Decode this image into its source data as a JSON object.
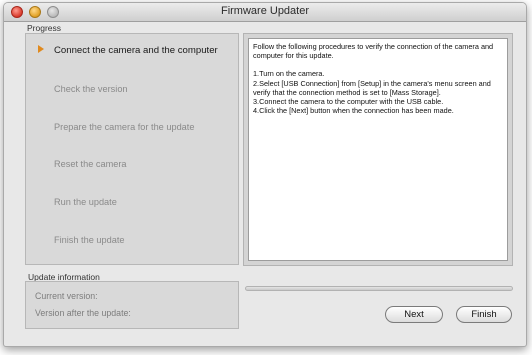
{
  "window": {
    "title": "Firmware Updater"
  },
  "progress": {
    "label": "Progress",
    "steps": [
      {
        "label": "Connect the camera and the computer",
        "active": true
      },
      {
        "label": "Check the version",
        "active": false
      },
      {
        "label": "Prepare the camera for the update",
        "active": false
      },
      {
        "label": "Reset the camera",
        "active": false
      },
      {
        "label": "Run the update",
        "active": false
      },
      {
        "label": "Finish the update",
        "active": false
      }
    ]
  },
  "instructions": {
    "intro": "Follow the following procedures to verify the connection of the camera and computer for this update.",
    "items": [
      "1.Turn on the camera.",
      "2.Select [USB Connection] from [Setup] in the camera's menu screen and verify that the connection method is set to [Mass Storage].",
      "3.Connect the camera to the computer with the USB cable.",
      "4.Click the [Next] button when the connection has been made."
    ]
  },
  "update_info": {
    "label": "Update information",
    "current_version": "Current version:",
    "version_after": "Version after the update:"
  },
  "progress_bar": {
    "fraction": 0
  },
  "buttons": {
    "next": "Next",
    "finish": "Finish"
  },
  "colors": {
    "active_arrow": "#e08a1e"
  }
}
